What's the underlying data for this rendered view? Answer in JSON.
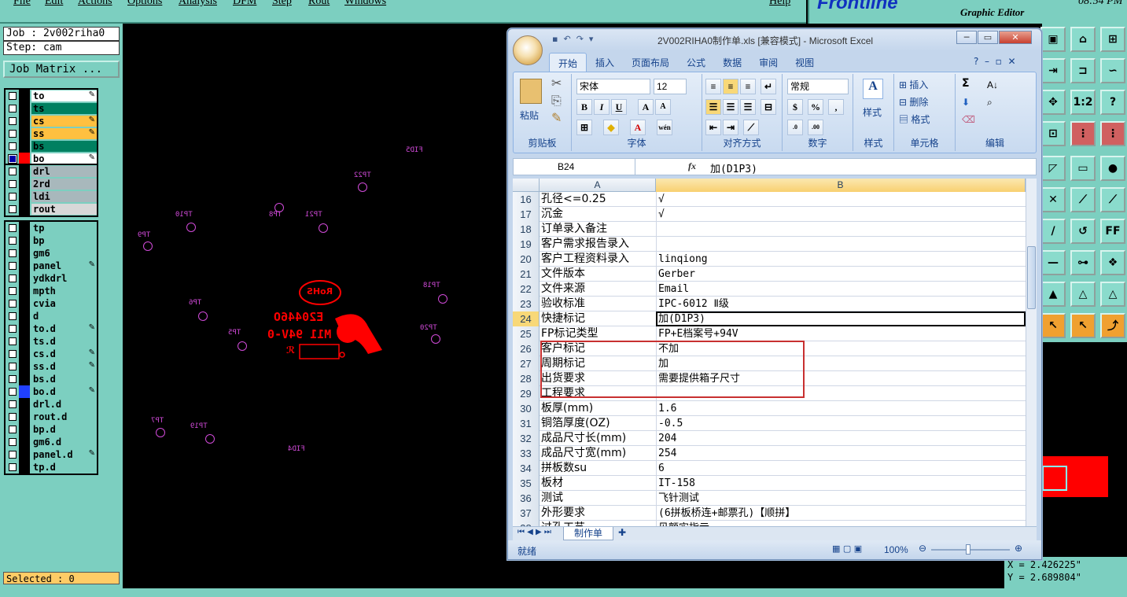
{
  "genesis": {
    "menu": [
      "File",
      "Edit",
      "Actions",
      "Options",
      "Analysis",
      "DFM",
      "Step",
      "Rout",
      "Windows",
      "Help"
    ],
    "logo": "Frontline",
    "editor_title": "Graphic Editor",
    "clock": "08:54 PM",
    "job": "Job : 2v002riha0",
    "step": "Step: cam",
    "job_matrix": "Job Matrix ...",
    "selected": "Selected : 0",
    "coord_x": "X = 2.426225\"",
    "coord_y": "Y = 2.689804\"",
    "layers": [
      {
        "name": "to",
        "color": "#ffffff",
        "icon": "edit-icon",
        "sw": "#000"
      },
      {
        "name": "ts",
        "color": "#008060",
        "icon": "",
        "sw": "#000"
      },
      {
        "name": "cs",
        "color": "#ffc040",
        "icon": "edit-icon",
        "sw": "#000"
      },
      {
        "name": "ss",
        "color": "#ffc040",
        "icon": "edit-icon",
        "sw": "#000"
      },
      {
        "name": "bs",
        "color": "#008060",
        "icon": "",
        "sw": "#000"
      },
      {
        "name": "bo",
        "color": "#ffffff",
        "icon": "edit-icon",
        "sw": "#ff0000",
        "on": true
      },
      {
        "name": "drl",
        "color": "#a8b8bc",
        "icon": "",
        "sw": "#000"
      },
      {
        "name": "2rd",
        "color": "#a8b8bc",
        "icon": "",
        "sw": "#000"
      },
      {
        "name": "ldi",
        "color": "#a8b8bc",
        "icon": "",
        "sw": "#000"
      },
      {
        "name": "rout",
        "color": "#d8d8d8",
        "icon": "",
        "sw": "#000"
      },
      {
        "name": "tp",
        "color": "#7ccfc0",
        "icon": "",
        "sw": "#000"
      },
      {
        "name": "bp",
        "color": "#7ccfc0",
        "icon": "",
        "sw": "#000"
      },
      {
        "name": "gm6",
        "color": "#7ccfc0",
        "icon": "",
        "sw": "#000"
      },
      {
        "name": "panel",
        "color": "#7ccfc0",
        "icon": "edit-icon",
        "sw": "#000"
      },
      {
        "name": "ydkdrl",
        "color": "#7ccfc0",
        "icon": "",
        "sw": "#000"
      },
      {
        "name": "mpth",
        "color": "#7ccfc0",
        "icon": "",
        "sw": "#000"
      },
      {
        "name": "cvia",
        "color": "#7ccfc0",
        "icon": "",
        "sw": "#000"
      },
      {
        "name": "d",
        "color": "#7ccfc0",
        "icon": "",
        "sw": "#000"
      },
      {
        "name": "to.d",
        "color": "#7ccfc0",
        "icon": "edit-icon",
        "sw": "#000"
      },
      {
        "name": "ts.d",
        "color": "#7ccfc0",
        "icon": "",
        "sw": "#000"
      },
      {
        "name": "cs.d",
        "color": "#7ccfc0",
        "icon": "edit-icon",
        "sw": "#000"
      },
      {
        "name": "ss.d",
        "color": "#7ccfc0",
        "icon": "edit-icon",
        "sw": "#000"
      },
      {
        "name": "bs.d",
        "color": "#7ccfc0",
        "icon": "",
        "sw": "#000"
      },
      {
        "name": "bo.d",
        "color": "#7ccfc0",
        "icon": "edit-icon",
        "sw": "#2040ff"
      },
      {
        "name": "drl.d",
        "color": "#7ccfc0",
        "icon": "",
        "sw": "#000"
      },
      {
        "name": "rout.d",
        "color": "#7ccfc0",
        "icon": "",
        "sw": "#000"
      },
      {
        "name": "bp.d",
        "color": "#7ccfc0",
        "icon": "",
        "sw": "#000"
      },
      {
        "name": "gm6.d",
        "color": "#7ccfc0",
        "icon": "",
        "sw": "#000"
      },
      {
        "name": "panel.d",
        "color": "#7ccfc0",
        "icon": "edit-icon",
        "sw": "#000"
      },
      {
        "name": "tp.d",
        "color": "#7ccfc0",
        "icon": "",
        "sw": "#000"
      }
    ],
    "canvas_labels": [
      "FID5",
      "TP22",
      "TP10",
      "TP8",
      "TP21",
      "TP9",
      "TP18",
      "TP6",
      "TP20",
      "TP5",
      "TP7",
      "TP19",
      "FID4"
    ],
    "silkscreen": {
      "rohs": "RoHS",
      "code": "E20446O",
      "ul": "M11 94V-0"
    }
  },
  "excel": {
    "title": "2V002RIHA0制作单.xls [兼容模式] - Microsoft Excel",
    "tabs": [
      "开始",
      "插入",
      "页面布局",
      "公式",
      "数据",
      "审阅",
      "视图"
    ],
    "groups": {
      "clipboard": "剪贴板",
      "paste": "粘贴",
      "font": "字体",
      "align": "对齐方式",
      "number": "数字",
      "styles": "样式",
      "cells": "单元格",
      "edit": "编辑"
    },
    "font_name": "宋体",
    "font_size": "12",
    "number_format": "常规",
    "insert": "插入",
    "delete": "删除",
    "format": "格式",
    "style_btn": "样式",
    "name_box": "B24",
    "formula": "加(D1P3)",
    "columns": [
      "A",
      "B"
    ],
    "rows": [
      {
        "n": "16",
        "a": "孔径<=0.25",
        "b": "√"
      },
      {
        "n": "17",
        "a": "沉金",
        "b": "√"
      },
      {
        "n": "18",
        "a": "订单录入备注",
        "b": ""
      },
      {
        "n": "19",
        "a": "客户需求报告录入",
        "b": ""
      },
      {
        "n": "20",
        "a": "客户工程资料录入",
        "b": "linqiong"
      },
      {
        "n": "21",
        "a": "文件版本",
        "b": "Gerber"
      },
      {
        "n": "22",
        "a": "文件来源",
        "b": "Email"
      },
      {
        "n": "23",
        "a": "验收标准",
        "b": "IPC-6012 Ⅱ级"
      },
      {
        "n": "24",
        "a": "快捷标记",
        "b": "加(D1P3)"
      },
      {
        "n": "25",
        "a": "FP标记类型",
        "b": "FP+E档案号+94V"
      },
      {
        "n": "26",
        "a": "客户标记",
        "b": "不加"
      },
      {
        "n": "27",
        "a": "周期标记",
        "b": "加"
      },
      {
        "n": "28",
        "a": "出货要求",
        "b": "需要提供箱子尺寸"
      },
      {
        "n": "29",
        "a": "工程要求",
        "b": ""
      },
      {
        "n": "30",
        "a": "板厚(mm)",
        "b": "1.6"
      },
      {
        "n": "31",
        "a": "铜箔厚度(OZ)",
        "b": "-0.5"
      },
      {
        "n": "32",
        "a": "成品尺寸长(mm)",
        "b": "204"
      },
      {
        "n": "33",
        "a": "成品尺寸宽(mm)",
        "b": "254"
      },
      {
        "n": "34",
        "a": "拼板数su",
        "b": "6"
      },
      {
        "n": "35",
        "a": "板材",
        "b": "IT-158"
      },
      {
        "n": "36",
        "a": "测试",
        "b": "飞针测试"
      },
      {
        "n": "37",
        "a": "外形要求",
        "b": "(6拼板桥连+邮票孔)【顺拼】"
      },
      {
        "n": "38",
        "a": "过孔工艺",
        "b": "见额实指示"
      }
    ],
    "selected_row": "24",
    "sheet_tab": "制作单",
    "status": "就绪",
    "zoom": "100%"
  }
}
